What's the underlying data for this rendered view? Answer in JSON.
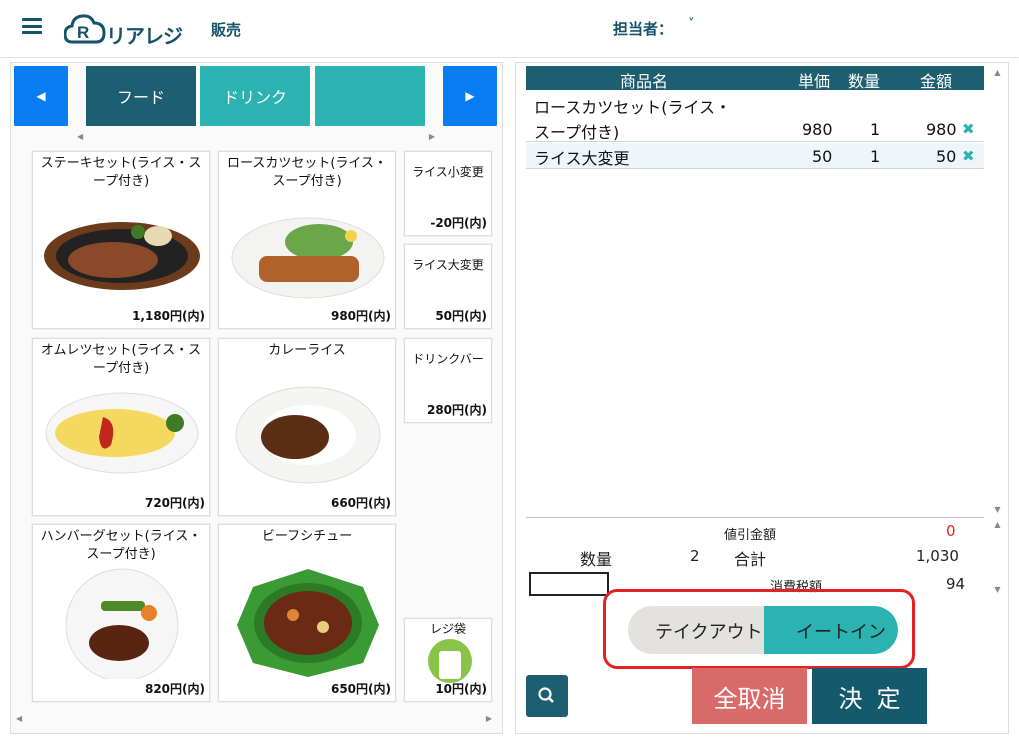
{
  "header": {
    "logo_text": "リアレジ",
    "nav_sales": "販売",
    "staff_label": "担当者："
  },
  "categories": {
    "food": "フード",
    "drink": "ドリンク",
    "empty": ""
  },
  "colors": {
    "brand": "#14536a",
    "teal": "#2ab3b0",
    "nav_blue": "#0a7cf2",
    "cancel": "#d86a6a",
    "highlight": "#e52222"
  },
  "products": [
    {
      "name": "ステーキセット(ライス・スープ付き)",
      "price": "1,180円(内)"
    },
    {
      "name": "ロースカツセット(ライス・スープ付き)",
      "price": "980円(内)"
    },
    {
      "name": "ライス小変更",
      "price": "-20円(内)"
    },
    {
      "name": "ライス大変更",
      "price": "50円(内)"
    },
    {
      "name": "オムレツセット(ライス・スープ付き)",
      "price": "720円(内)"
    },
    {
      "name": "カレーライス",
      "price": "660円(内)"
    },
    {
      "name": "ドリンクバー",
      "price": "280円(内)"
    },
    {
      "name": "ハンバーグセット(ライス・スープ付き)",
      "price": "820円(内)"
    },
    {
      "name": "ビーフシチュー",
      "price": "650円(内)"
    },
    {
      "name": "レジ袋",
      "price": "10円(内)"
    }
  ],
  "order": {
    "headers": {
      "name": "商品名",
      "unit": "単価",
      "qty": "数量",
      "amount": "金額"
    },
    "rows": [
      {
        "name_l1": "ロースカツセット(ライス・",
        "name_l2": "スープ付き)",
        "unit": "980",
        "qty": "1",
        "amount": "980"
      },
      {
        "name_l1": "ライス大変更",
        "name_l2": "",
        "unit": "50",
        "qty": "1",
        "amount": "50"
      }
    ]
  },
  "summary": {
    "discount_label": "値引金額",
    "discount": "0",
    "qty_label": "数量",
    "qty": "2",
    "total_label": "合計",
    "total": "1,030",
    "tax_label": "消費税額",
    "tax": "94"
  },
  "toggle": {
    "takeout": "テイクアウト",
    "eatin": "イートイン",
    "selected": "イートイン"
  },
  "buttons": {
    "cancel": "全取消",
    "ok": "決定"
  }
}
